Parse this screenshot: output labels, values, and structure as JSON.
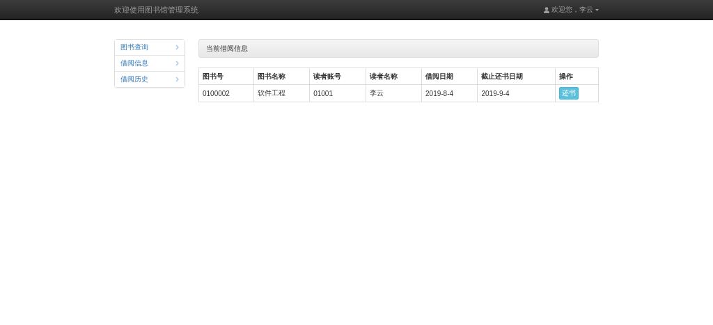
{
  "navbar": {
    "brand": "欢迎使用图书馆管理系统",
    "user": "欢迎您，李云"
  },
  "sidebar": {
    "items": [
      {
        "label": "图书查询",
        "selected": false
      },
      {
        "label": "借阅信息",
        "selected": false
      },
      {
        "label": "借阅历史",
        "selected": false
      }
    ]
  },
  "panel": {
    "title": "当前借阅信息"
  },
  "table": {
    "columns": [
      "图书号",
      "图书名称",
      "读者账号",
      "读者名称",
      "借阅日期",
      "截止还书日期",
      "操作"
    ],
    "rows": [
      {
        "cells": [
          "0100002",
          "软件工程",
          "01001",
          "李云",
          "2019-8-4",
          "2019-9-4"
        ],
        "action": "还书"
      }
    ]
  }
}
